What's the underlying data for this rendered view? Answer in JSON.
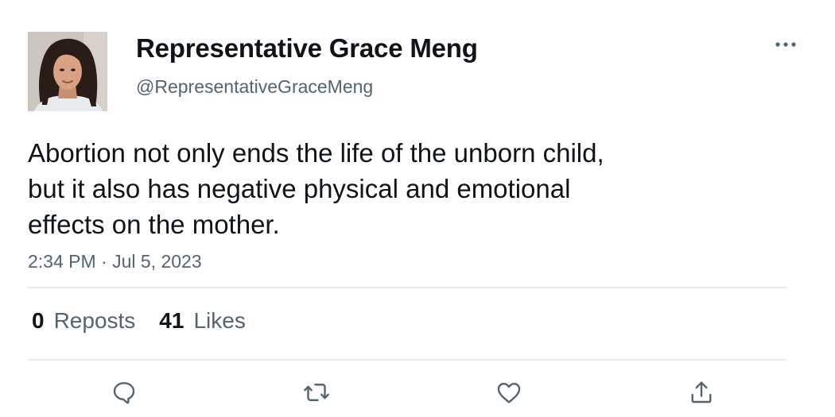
{
  "author": {
    "display_name": "Representative Grace Meng",
    "handle": "@RepresentativeGraceMeng",
    "avatar_icon": "profile-photo"
  },
  "tweet": {
    "lines": [
      "Abortion not only ends the life of the unborn child,",
      "but it also has negative physical and emotional",
      "effects on the mother."
    ],
    "timestamp": "2:34 PM · Jul 5, 2023"
  },
  "stats": {
    "reposts_count": "0",
    "reposts_label": "Reposts",
    "likes_count": "41",
    "likes_label": "Likes"
  },
  "actions": {
    "reply_icon": "speech-bubble-icon",
    "repost_icon": "repost-arrows-icon",
    "like_icon": "heart-icon",
    "share_icon": "share-upload-icon",
    "more_icon": "ellipsis-icon"
  },
  "colors": {
    "text_primary": "#0f1419",
    "text_secondary": "#536471",
    "divider": "#e6e9eb"
  }
}
